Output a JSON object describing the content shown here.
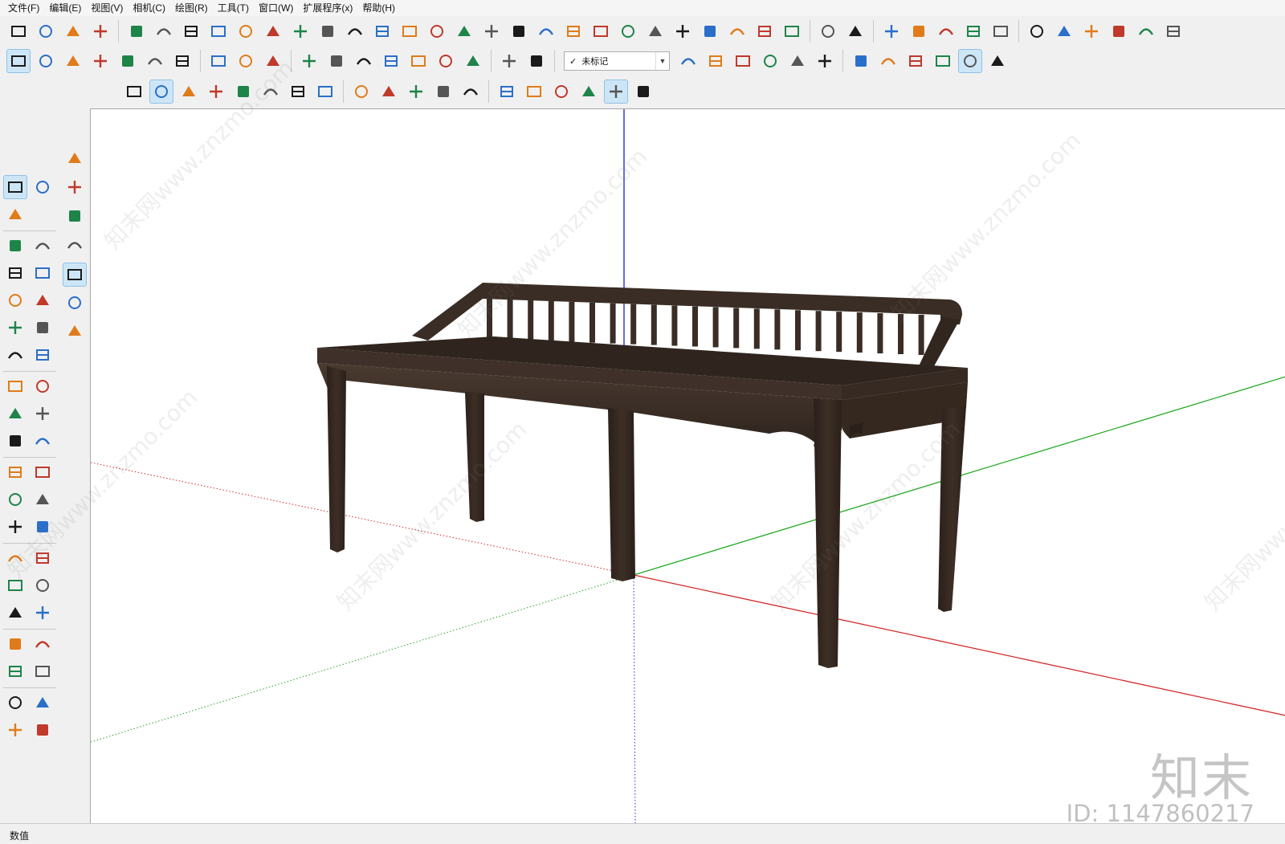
{
  "menu": [
    "文件(F)",
    "编辑(E)",
    "视图(V)",
    "相机(C)",
    "绘图(R)",
    "工具(T)",
    "窗口(W)",
    "扩展程序(x)",
    "帮助(H)"
  ],
  "layer": {
    "check": "✓",
    "name": "未标记"
  },
  "status": {
    "label": "数值"
  },
  "watermark": {
    "text": "知末网www.znzmo.com",
    "logo": "知末",
    "id": "ID: 1147860217"
  },
  "colors": {
    "axis_red": "#d42a2a",
    "axis_green": "#22aa22",
    "axis_blue": "#2a2ad8",
    "bench_wood": "#3b2e26",
    "active_tool": "#cde6f7"
  },
  "icons": {
    "row1": [
      "sandbox-from-contours-icon",
      "wall-icon",
      "stairs-icon",
      "bar-chart-icon",
      "section-plane-icon",
      "line-array-icon",
      "curve-tool-icon",
      "branch-tool-icon",
      "arc-frame-icon",
      "rotate-curve-icon",
      "tree-icon",
      "pill-shape-icon",
      "node-tool-icon",
      "grid-plane-icon",
      "grid-tilted-icon",
      "chess-piece-icon",
      "stack-icon",
      "arch-icon",
      "dots-line-icon",
      "wave-line-icon",
      "spiral-icon",
      "ramp-icon",
      "comb-icon",
      "fence-icon",
      "mirror-icon",
      "dot-grid-icon",
      "panel-icon",
      "compass-icon",
      "brush-icon",
      "calculator-icon",
      "camera-lens-icon",
      "folder-export-icon",
      "checkbox-icon",
      "cloud-upload-icon",
      "cube-search-icon",
      "sync-icon",
      "warehouse-icon",
      "cabinet-icon",
      "house-icon",
      "house-store-icon",
      "house-outline-icon",
      "house-flat-icon"
    ],
    "row2": [
      "curve-wave-icon",
      "cloud-node-icon",
      "cloud-check-icon",
      "cloud-lines-icon",
      "square-scale-icon",
      "flower-node-icon",
      "rotate-refresh-icon",
      "slope-icon",
      "frame-bracket-icon",
      "follow-me-icon",
      "extrude-icon",
      "box-orange-icon",
      "cylinder-icon",
      "shear-icon",
      "arrow-flat-icon",
      "cross-cut-icon",
      "path-sweep-icon",
      "frame-orange-icon",
      "frame-rotate-icon",
      "stack-view-1-icon",
      "stack-view-2-icon",
      "stack-view-3-icon",
      "stack-view-4-icon",
      "stack-view-5-icon",
      "stack-view-6-icon",
      "wire-box-icon",
      "hidden-line-icon",
      "shaded-icon",
      "textured-icon",
      "monochrome-icon",
      "xray-box-icon"
    ],
    "row3": [
      "play-icon",
      "pause-icon",
      "record-icon",
      "stop-icon",
      "settings-icon",
      "film-icon",
      "film-delete-icon",
      "help-icon",
      "point-icon",
      "cone-icon",
      "dash-icon",
      "rectangle-icon",
      "eye-hide-icon",
      "purple-plugin-icon",
      "orbit-refresh-icon",
      "camera-switch-icon",
      "camera-icon",
      "lens-active-icon",
      "gear-flower-icon"
    ],
    "side": [
      "orange-down-icon",
      "orange-chevron-icon",
      "red-sphere-icon",
      "red-gears-icon"
    ]
  },
  "left_tools": [
    [
      "select-arrow-icon",
      "component-icon"
    ],
    [
      "eraser-icon",
      ""
    ],
    [
      "pencil-icon",
      "freehand-icon"
    ],
    [
      "rectangle-tool-icon",
      "rotated-rect-icon"
    ],
    [
      "circle-tool-icon",
      "polygon-tool-icon"
    ],
    [
      "arc-tool-icon",
      "arc-2pt-icon"
    ],
    [
      "arc-3pt-icon",
      "pie-icon"
    ],
    [
      "move-tool-icon",
      "push-pull-icon"
    ],
    [
      "rotate-tool-icon",
      "follow-me-tool-icon"
    ],
    [
      "scale-tool-icon",
      "offset-tool-icon"
    ],
    [
      "tape-measure-icon",
      "dimension-icon"
    ],
    [
      "protractor-icon",
      "text-tool-icon"
    ],
    [
      "axes-tool-icon",
      "3d-text-icon"
    ],
    [
      "orbit-tool-icon",
      "pan-tool-icon"
    ],
    [
      "zoom-tool-icon",
      "zoom-window-icon"
    ],
    [
      "zoom-extents-icon",
      "previous-view-icon"
    ],
    [
      "position-camera-icon",
      "look-around-icon"
    ],
    [
      "walk-icon",
      "section-plane-tool-icon"
    ],
    [
      "sandbox-icon",
      "smoove-icon"
    ],
    [
      "stamp-icon",
      "drape-icon"
    ]
  ]
}
